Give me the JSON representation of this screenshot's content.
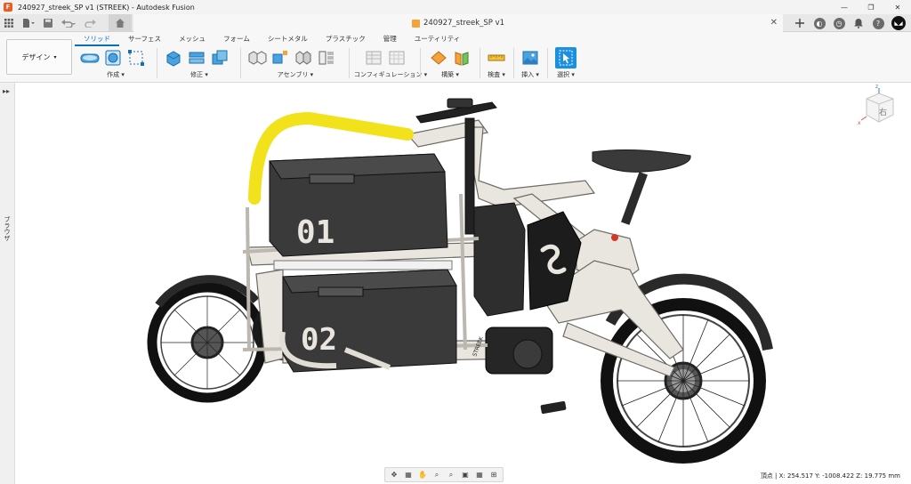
{
  "window": {
    "title": "240927_streek_SP v1 (STREEK) - Autodesk Fusion",
    "minimize": "—",
    "maximize": "❐",
    "close": "✕"
  },
  "document_tab": {
    "name": "240927_streek_SP v1",
    "close": "✕"
  },
  "workspace": {
    "label": "デザイン",
    "caret": "▾"
  },
  "ribbon_tabs": [
    {
      "label": "ソリッド",
      "active": true
    },
    {
      "label": "サーフェス"
    },
    {
      "label": "メッシュ"
    },
    {
      "label": "フォーム"
    },
    {
      "label": "シートメタル"
    },
    {
      "label": "プラスチック"
    },
    {
      "label": "管理"
    },
    {
      "label": "ユーティリティ"
    }
  ],
  "ribbon_groups": [
    {
      "label": "作成 ▾"
    },
    {
      "label": "修正 ▾"
    },
    {
      "label": "アセンブリ ▾"
    },
    {
      "label": "コンフィギュレーション ▾"
    },
    {
      "label": "構築 ▾"
    },
    {
      "label": "検査 ▾"
    },
    {
      "label": "挿入 ▾"
    },
    {
      "label": "選択 ▾"
    }
  ],
  "browser": {
    "toggle": "▸▸",
    "label": "ブラウザ"
  },
  "viewcube": {
    "face": "右",
    "axis_x": "x",
    "axis_z": "z"
  },
  "model": {
    "box_top_number": "01",
    "box_bottom_number": "02",
    "frame_label": "STREEK"
  },
  "status": {
    "text": "頂点 | X: 254.517 Y: -1008.422 Z: 19.775 mm"
  },
  "colors": {
    "accent": "#0a6ebd",
    "frame": "#e9e6df",
    "handle_yellow": "#f2e21b",
    "box": "#3a3a3a"
  }
}
